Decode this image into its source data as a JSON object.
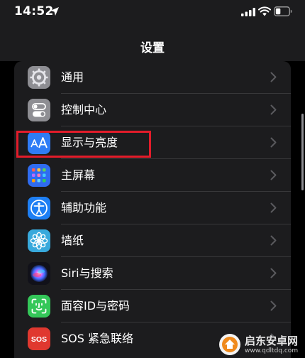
{
  "status_bar": {
    "time": "14:52",
    "icons": [
      "location-arrow-icon",
      "cellular-signal-icon",
      "wifi-icon",
      "battery-icon"
    ]
  },
  "nav": {
    "title": "设置"
  },
  "items": [
    {
      "label": "通用",
      "icon": "gear-icon",
      "color": "#8e8e93"
    },
    {
      "label": "控制中心",
      "icon": "toggles-icon",
      "color": "#8e8e93"
    },
    {
      "label": "显示与亮度",
      "icon": "text-size-icon",
      "color": "#2f7cf6"
    },
    {
      "label": "主屏幕",
      "icon": "home-screen-grid-icon",
      "color": "#2f6cf0"
    },
    {
      "label": "辅助功能",
      "icon": "accessibility-icon",
      "color": "#1e7ff4"
    },
    {
      "label": "墙纸",
      "icon": "flower-icon",
      "color": "#38a9dc"
    },
    {
      "label": "Siri与搜索",
      "icon": "siri-icon",
      "color": "#1a1a2e"
    },
    {
      "label": "面容ID与密码",
      "icon": "face-id-icon",
      "color": "#34c759"
    },
    {
      "label": "SOS 紧急联络",
      "icon": "sos-icon",
      "color": "#e0382f"
    }
  ],
  "sos_badge": "SOS",
  "highlight_color": "#e21c2a",
  "watermark": {
    "name": "启东安卓网",
    "url": "www.qdltdq.com"
  }
}
